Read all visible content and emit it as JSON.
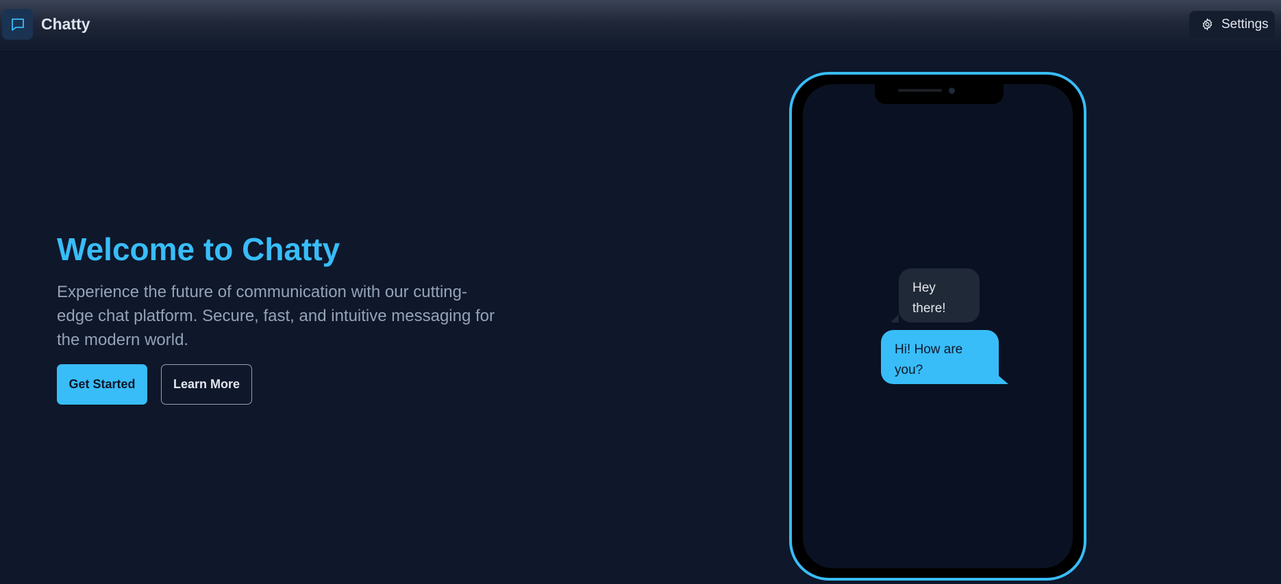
{
  "header": {
    "brand": "Chatty",
    "logo_icon": "chat-bubble-icon",
    "settings_label": "Settings",
    "settings_icon": "gear-icon"
  },
  "hero": {
    "title": "Welcome to Chatty",
    "subtitle": "Experience the future of communication with our cutting-edge chat platform. Secure, fast, and intuitive messaging for the modern world.",
    "primary_button": "Get Started",
    "secondary_button": "Learn More"
  },
  "phone_preview": {
    "messages": [
      {
        "from": "other",
        "text": "Hey there!"
      },
      {
        "from": "me",
        "text": "Hi! How are you?"
      }
    ]
  },
  "colors": {
    "accent": "#38bdf8",
    "background": "#0f172a",
    "muted_text": "#94a3b8",
    "incoming_bubble": "#1f2937"
  }
}
